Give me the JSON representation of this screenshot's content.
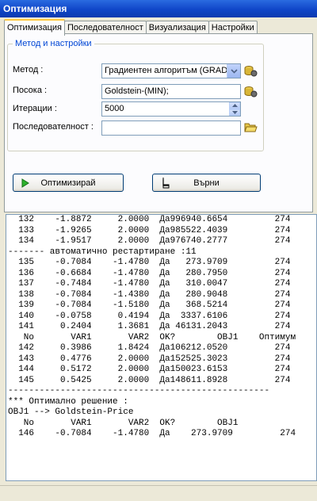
{
  "window": {
    "title": "Оптимизация"
  },
  "tabs": [
    {
      "label": "Оптимизация"
    },
    {
      "label": "Последователност"
    },
    {
      "label": "Визуализация"
    },
    {
      "label": "Настройки"
    }
  ],
  "settings": {
    "group_title": "Метод и настройки",
    "method_label": "Метод :",
    "method_value": "Градиентен алгоритъм (GRAD",
    "direction_label": "Посока :",
    "direction_value": "Goldstein-(MIN);",
    "iterations_label": "Итерации :",
    "iterations_value": "5000",
    "sequence_label": "Последователност :",
    "sequence_value": ""
  },
  "buttons": {
    "optimize": "Оптимизирай",
    "return": "Върни"
  },
  "output_lines": [
    "  132    -1.8872     2.0000  Да996940.6654         274",
    "  133    -1.9265     2.0000  Да985522.4039         274",
    "  134    -1.9517     2.0000  Да976740.2777         274",
    "------- автоматично рестартиране :11",
    "  135    -0.7084    -1.4780  Да   273.9709         274",
    "  136    -0.6684    -1.4780  Да   280.7950         274",
    "  137    -0.7484    -1.4780  Да   310.0047         274",
    "  138    -0.7084    -1.4380  Да   280.9048         274",
    "  139    -0.7084    -1.5180  Да   368.5214         274",
    "  140    -0.0758     0.4194  Да  3337.6106         274",
    "  141     0.2404     1.3681  Да 46131.2043         274",
    "   No       VAR1       VAR2  OK?        OBJ1    Оптимум",
    "  142     0.3986     1.8424  Да106212.0520         274",
    "  143     0.4776     2.0000  Да152525.3023         274",
    "  144     0.5172     2.0000  Да150023.6153         274",
    "  145     0.5425     2.0000  Да148611.8928         274",
    "--------------------------------------------------",
    "*** Оптимално решение :",
    "OBJ1 --> Goldstein-Price",
    "   No       VAR1       VAR2  OK?        OBJ1",
    "  146    -0.7084    -1.4780  Да    273.9709         274"
  ]
}
